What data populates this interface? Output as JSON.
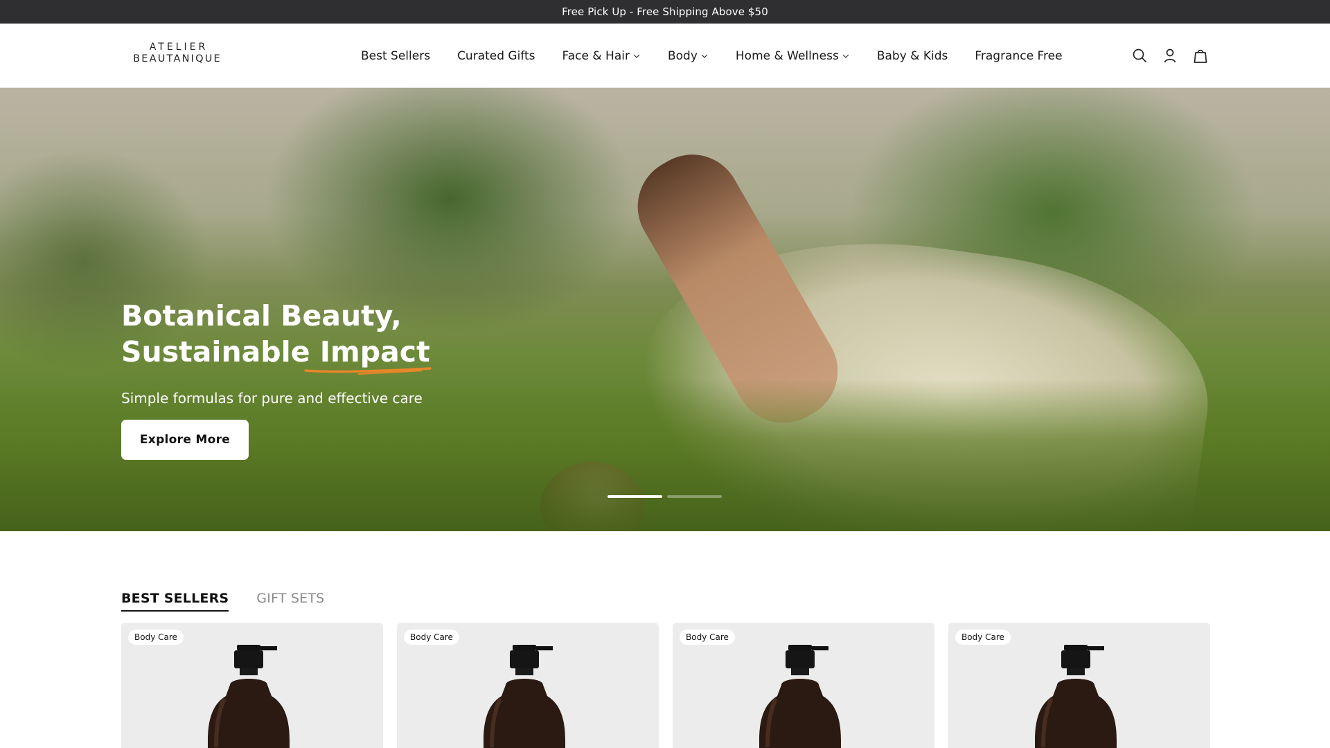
{
  "announcement": {
    "text": "Free Pick Up - Free Shipping Above $50"
  },
  "brand": {
    "line1": "ATELIER",
    "line2": "BEAUTANIQUE"
  },
  "nav": {
    "items": [
      {
        "label": "Best Sellers",
        "has_dropdown": false
      },
      {
        "label": "Curated Gifts",
        "has_dropdown": false
      },
      {
        "label": "Face & Hair",
        "has_dropdown": true
      },
      {
        "label": "Body",
        "has_dropdown": true
      },
      {
        "label": "Home & Wellness",
        "has_dropdown": true
      },
      {
        "label": "Baby & Kids",
        "has_dropdown": false
      },
      {
        "label": "Fragrance Free",
        "has_dropdown": false
      }
    ]
  },
  "header_icons": [
    "search-icon",
    "account-icon",
    "bag-icon"
  ],
  "hero": {
    "title_line1": "Botanical Beauty,",
    "title_line2_prefix": "Sustainable ",
    "title_line2_accent": "Impact",
    "subtitle": "Simple formulas for pure and effective care",
    "button_label": "Explore More",
    "slides_total": 2,
    "slide_active": 1,
    "accent_color": "#e8862a"
  },
  "products_section": {
    "tabs": [
      {
        "label": "BEST SELLERS",
        "active": true
      },
      {
        "label": "GIFT SETS",
        "active": false
      }
    ],
    "cards": [
      {
        "badge": "Body Care"
      },
      {
        "badge": "Body Care"
      },
      {
        "badge": "Body Care"
      },
      {
        "badge": "Body Care"
      }
    ]
  },
  "colors": {
    "announcement_bg": "#2f2f31",
    "card_bg": "#ececec",
    "text_dark": "#111111"
  }
}
